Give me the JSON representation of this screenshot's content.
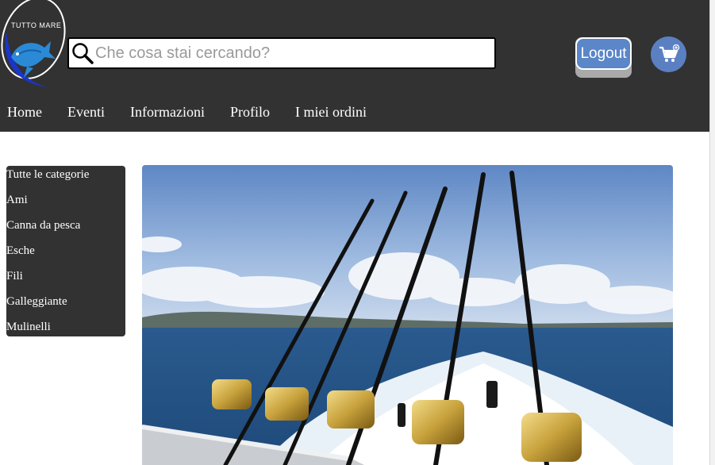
{
  "logo": {
    "text": "TUTTO MARE",
    "icon": "fish-logo-icon"
  },
  "search": {
    "placeholder": "Che cosa stai cercando?",
    "icon": "search-icon"
  },
  "header": {
    "logout_label": "Logout",
    "cart_icon": "cart-icon"
  },
  "nav": {
    "items": [
      "Home",
      "Eventi",
      "Informazioni",
      "Profilo",
      "I miei ordini"
    ]
  },
  "sidebar": {
    "categories": [
      "Tutte le categorie",
      "Ami",
      "Canna da pesca",
      "Esche",
      "Fili",
      "Galleggiante",
      "Mulinelli"
    ]
  },
  "hero": {
    "subject": "fishing-rods-on-boat-image"
  },
  "colors": {
    "header_bg": "#323232",
    "accent": "#5b86c8",
    "cart": "#5a80c2"
  }
}
